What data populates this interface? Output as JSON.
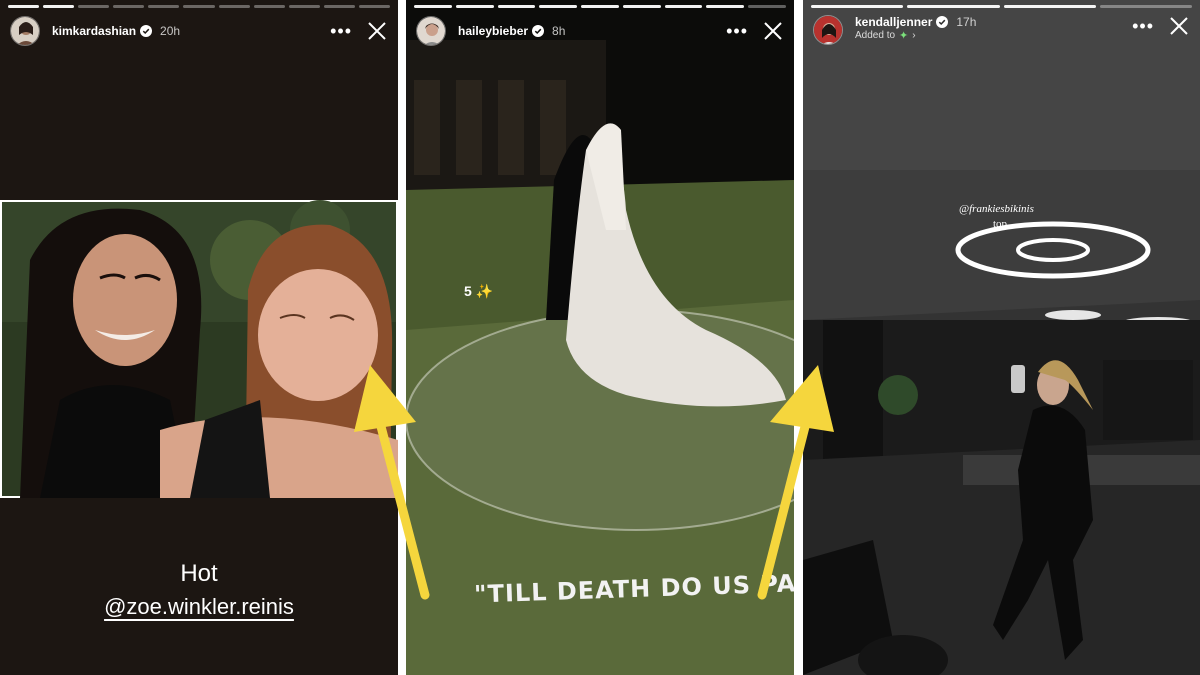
{
  "stories": [
    {
      "username": "kimkardashian",
      "time": "20h",
      "caption": "Hot",
      "mention": "@zoe.winkler.reinis"
    },
    {
      "username": "haileybieber",
      "time": "8h",
      "sticker": "5 ✨",
      "overlay_text": "\"TILL DEATH DO US PA"
    },
    {
      "username": "kendalljenner",
      "time": "17h",
      "added_to": "Added to",
      "tag": "@frankiesbikinis",
      "tag_sub": "top"
    }
  ],
  "colors": {
    "arrow": "#f5d63d",
    "verified": "#3897f0"
  },
  "icons": [
    "more-icon",
    "close-icon",
    "verified-badge-icon",
    "chevron-right-icon"
  ]
}
